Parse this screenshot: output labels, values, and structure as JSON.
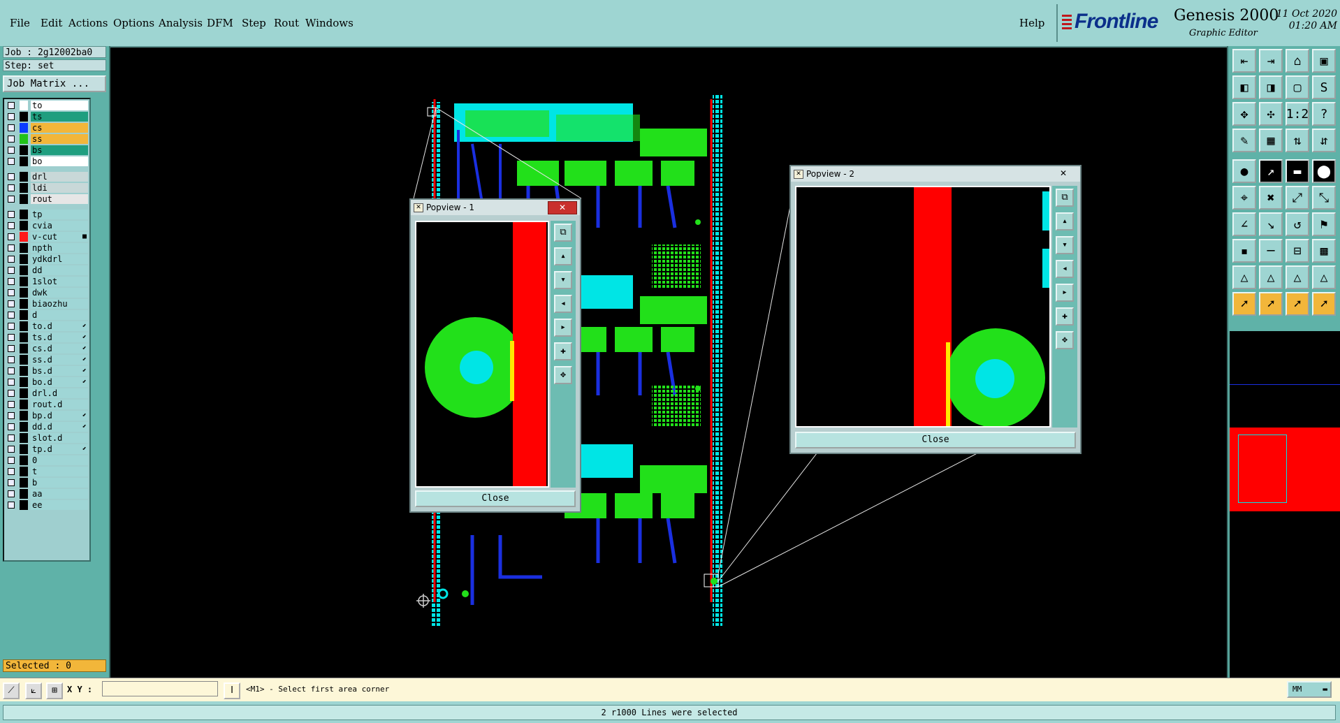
{
  "menu": {
    "items": [
      "File",
      "Edit",
      "Actions",
      "Options",
      "Analysis",
      "DFM",
      "Step",
      "Rout",
      "Windows"
    ],
    "help": "Help"
  },
  "brand": {
    "logo": "Frontline",
    "app": "Genesis 2000",
    "subtitle": "Graphic Editor",
    "date": "11 Oct 2020",
    "time": "01:20 AM"
  },
  "left": {
    "job": "Job : 2g12002ba0",
    "step": "Step: set",
    "job_matrix": "Job Matrix ...",
    "selected": "Selected : 0",
    "layers": [
      {
        "name": "to",
        "color": "#ffffff",
        "bg": "#ffffff",
        "flag": ""
      },
      {
        "name": "ts",
        "color": "#000000",
        "bg": "#1f9e7f",
        "flag": ""
      },
      {
        "name": "cs",
        "color": "#0a3cff",
        "bg": "#f2b63a",
        "flag": ""
      },
      {
        "name": "ss",
        "color": "#22c21a",
        "bg": "#f2b63a",
        "flag": ""
      },
      {
        "name": "bs",
        "color": "#000000",
        "bg": "#1f9e7f",
        "flag": ""
      },
      {
        "name": "bo",
        "color": "#000000",
        "bg": "#ffffff",
        "flag": ""
      },
      {
        "name": "drl",
        "color": "#000000",
        "bg": "#c8d8d8",
        "flag": ""
      },
      {
        "name": "ldi",
        "color": "#000000",
        "bg": "#c8d8d8",
        "flag": ""
      },
      {
        "name": "rout",
        "color": "#000000",
        "bg": "#e6e6e6",
        "flag": ""
      },
      {
        "name": "tp",
        "color": "#000000",
        "bg": "#9fd6d6",
        "flag": ""
      },
      {
        "name": "cvia",
        "color": "#000000",
        "bg": "#9fd6d6",
        "flag": ""
      },
      {
        "name": "v-cut",
        "color": "#ff1a1a",
        "bg": "#9fd6d6",
        "flag": "■"
      },
      {
        "name": "npth",
        "color": "#000000",
        "bg": "#9fd6d6",
        "flag": ""
      },
      {
        "name": "ydkdrl",
        "color": "#000000",
        "bg": "#9fd6d6",
        "flag": ""
      },
      {
        "name": "dd",
        "color": "#000000",
        "bg": "#9fd6d6",
        "flag": ""
      },
      {
        "name": "1slot",
        "color": "#000000",
        "bg": "#9fd6d6",
        "flag": ""
      },
      {
        "name": "dwk",
        "color": "#000000",
        "bg": "#9fd6d6",
        "flag": ""
      },
      {
        "name": "biaozhu",
        "color": "#000000",
        "bg": "#9fd6d6",
        "flag": ""
      },
      {
        "name": "d",
        "color": "#000000",
        "bg": "#9fd6d6",
        "flag": ""
      },
      {
        "name": "to.d",
        "color": "#000000",
        "bg": "#9fd6d6",
        "flag": "⬋"
      },
      {
        "name": "ts.d",
        "color": "#000000",
        "bg": "#9fd6d6",
        "flag": "⬋"
      },
      {
        "name": "cs.d",
        "color": "#000000",
        "bg": "#9fd6d6",
        "flag": "⬋"
      },
      {
        "name": "ss.d",
        "color": "#000000",
        "bg": "#9fd6d6",
        "flag": "⬋"
      },
      {
        "name": "bs.d",
        "color": "#000000",
        "bg": "#9fd6d6",
        "flag": "⬋"
      },
      {
        "name": "bo.d",
        "color": "#000000",
        "bg": "#9fd6d6",
        "flag": "⬋"
      },
      {
        "name": "drl.d",
        "color": "#000000",
        "bg": "#9fd6d6",
        "flag": ""
      },
      {
        "name": "rout.d",
        "color": "#000000",
        "bg": "#9fd6d6",
        "flag": ""
      },
      {
        "name": "bp.d",
        "color": "#000000",
        "bg": "#9fd6d6",
        "flag": "⬋"
      },
      {
        "name": "dd.d",
        "color": "#000000",
        "bg": "#9fd6d6",
        "flag": "⬋"
      },
      {
        "name": "slot.d",
        "color": "#000000",
        "bg": "#9fd6d6",
        "flag": ""
      },
      {
        "name": "tp.d",
        "color": "#000000",
        "bg": "#9fd6d6",
        "flag": "⬋"
      },
      {
        "name": "0",
        "color": "#000000",
        "bg": "#9fd6d6",
        "flag": ""
      },
      {
        "name": "t",
        "color": "#000000",
        "bg": "#9fd6d6",
        "flag": ""
      },
      {
        "name": "b",
        "color": "#000000",
        "bg": "#9fd6d6",
        "flag": ""
      },
      {
        "name": "aa",
        "color": "#000000",
        "bg": "#9fd6d6",
        "flag": ""
      },
      {
        "name": "ee",
        "color": "#000000",
        "bg": "#9fd6d6",
        "flag": ""
      }
    ]
  },
  "popview1": {
    "title": "Popview - 1",
    "close_label": "Close"
  },
  "popview2": {
    "title": "Popview - 2",
    "close_label": "Close"
  },
  "bottom": {
    "xy_label": "X Y :",
    "xy_value": "",
    "prompt": "<M1> - Select first area corner",
    "units": "MM",
    "status": "2 r1000 Lines were selected"
  },
  "colors": {
    "panel": "#5fb2a8",
    "menubar": "#9ed5d2",
    "route_red": "#ff0000",
    "pad_green": "#22e01a",
    "pad_cyan": "#00e5e5",
    "trace_blue": "#1a2fe0",
    "selected_bar": "#f2b63a"
  }
}
